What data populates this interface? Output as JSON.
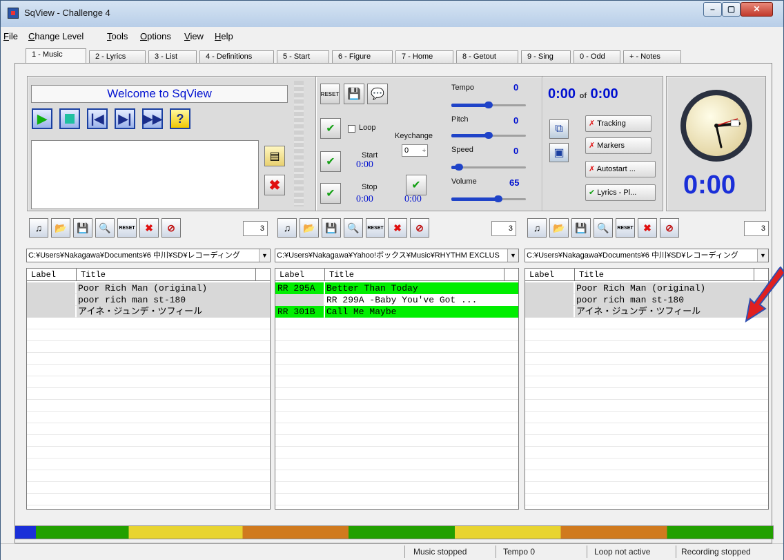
{
  "window": {
    "title": "SqView - Challenge 4"
  },
  "menu": [
    "File",
    "Change Level",
    "Tools",
    "Options",
    "View",
    "Help"
  ],
  "tabs": [
    "1 - Music",
    "2 - Lyrics",
    "3 - List",
    "4 - Definitions",
    "5 - Start",
    "6 - Figure",
    "7 - Home",
    "8 - Getout",
    "9 - Sing",
    "0 - Odd",
    "+ - Notes"
  ],
  "player": {
    "welcome": "Welcome to SqView",
    "loop_label": "Loop",
    "keychange_label": "Keychange",
    "keychange_value": "0",
    "start_label": "Start",
    "start_time": "0:00",
    "stop_label": "Stop",
    "stop_time": "0:00",
    "stop_time2": "0:00",
    "reset_label": "RESET"
  },
  "sliders": {
    "tempo": {
      "label": "Tempo",
      "value": "0",
      "level": 0.5
    },
    "pitch": {
      "label": "Pitch",
      "value": "0",
      "level": 0.5
    },
    "speed": {
      "label": "Speed",
      "value": "0",
      "level": 0.05
    },
    "volume": {
      "label": "Volume",
      "value": "65",
      "level": 0.65
    }
  },
  "timer": {
    "elapsed": "0:00",
    "of": "of",
    "total": "0:00",
    "big": "0:00"
  },
  "toggles": {
    "tracking": "Tracking",
    "markers": "Markers",
    "autostart": "Autostart ...",
    "lyrics": "Lyrics - Pl..."
  },
  "lists": [
    {
      "path": "C:¥Users¥Nakagawa¥Documents¥6 中川¥SD¥レコーディング",
      "count": "3",
      "header_label": "Label",
      "header_title": "Title",
      "rows": [
        {
          "label": "",
          "title": "Poor Rich Man  (original)"
        },
        {
          "label": "",
          "title": "poor rich man  st-180"
        },
        {
          "label": "",
          "title": "アイネ・ジュンデ・ツフィール"
        }
      ]
    },
    {
      "path": "C:¥Users¥Nakagawa¥Yahoo!ボックス¥Music¥RHYTHM EXCLUS",
      "count": "3",
      "header_label": "Label",
      "header_title": "Title",
      "rows": [
        {
          "label": "RR 295A",
          "title": "Better Than  Today"
        },
        {
          "label": "",
          "title": "RR 299A -Baby You've Got ..."
        },
        {
          "label": "RR 301B",
          "title": "Call Me Maybe"
        }
      ]
    },
    {
      "path": "C:¥Users¥Nakagawa¥Documents¥6 中川¥SD¥レコーディング",
      "count": "3",
      "header_label": "Label",
      "header_title": "Title",
      "rows": [
        {
          "label": "",
          "title": "Poor Rich Man  (original)"
        },
        {
          "label": "",
          "title": "poor rich man  st-180"
        },
        {
          "label": "",
          "title": "アイネ・ジュンデ・ツフィール"
        }
      ]
    }
  ],
  "status": {
    "music": "Music stopped",
    "tempo": "Tempo 0",
    "loop": "Loop not active",
    "recording": "Recording stopped"
  },
  "colors": {
    "accent_blue": "#1f43c8",
    "highlight_green": "#00ee00",
    "row_gray": "#d8d8d8",
    "arrow_red": "#e02020"
  }
}
